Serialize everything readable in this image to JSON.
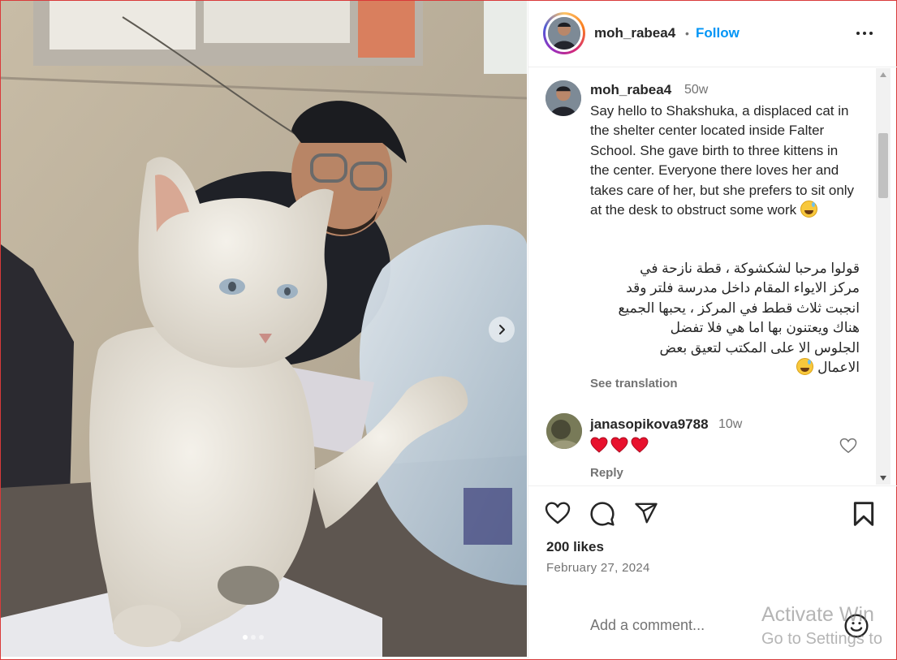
{
  "post": {
    "username": "moh_rabea4",
    "separator": "•",
    "follow_label": "Follow",
    "more_label": "More options",
    "caption": {
      "username": "moh_rabea4",
      "time": "50w",
      "text_en": "Say hello to Shakshuka, a displaced cat in the shelter center located inside Falter School. She gave birth to three kittens in the center. Everyone there loves her and takes care of her, but she prefers to sit only at the desk to obstruct some work",
      "text_ar_lines": [
        "قولوا مرحبا لشكشوكة ، قطة نازحة في",
        "مركز الايواء المقام داخل مدرسة فلتر وقد",
        "انجبت ثلاث قطط في المركز ، يحبها الجميع",
        "هناك ويعتنون بها اما هي فلا تفضل",
        "الجلوس الا على المكتب لتعيق بعض",
        "الاعمال"
      ],
      "emoji_icon": "grinning-sweat-emoji",
      "see_translation": "See translation"
    },
    "comments": [
      {
        "username": "janasopikova9788",
        "time": "10w",
        "text": "❤️❤️❤️",
        "reply_label": "Reply"
      }
    ],
    "likes": "200 likes",
    "date": "February 27, 2024",
    "add_comment_placeholder": "Add a comment...",
    "carousel": {
      "slide_count": 3,
      "active_slide": 1
    }
  },
  "watermark": {
    "line1": "Activate Win",
    "line2": "Go to Settings to"
  },
  "colors": {
    "accent": "#0095f6",
    "text": "#262626",
    "muted": "#737373",
    "heart": "#e0245e",
    "frame": "#d93a3a"
  }
}
